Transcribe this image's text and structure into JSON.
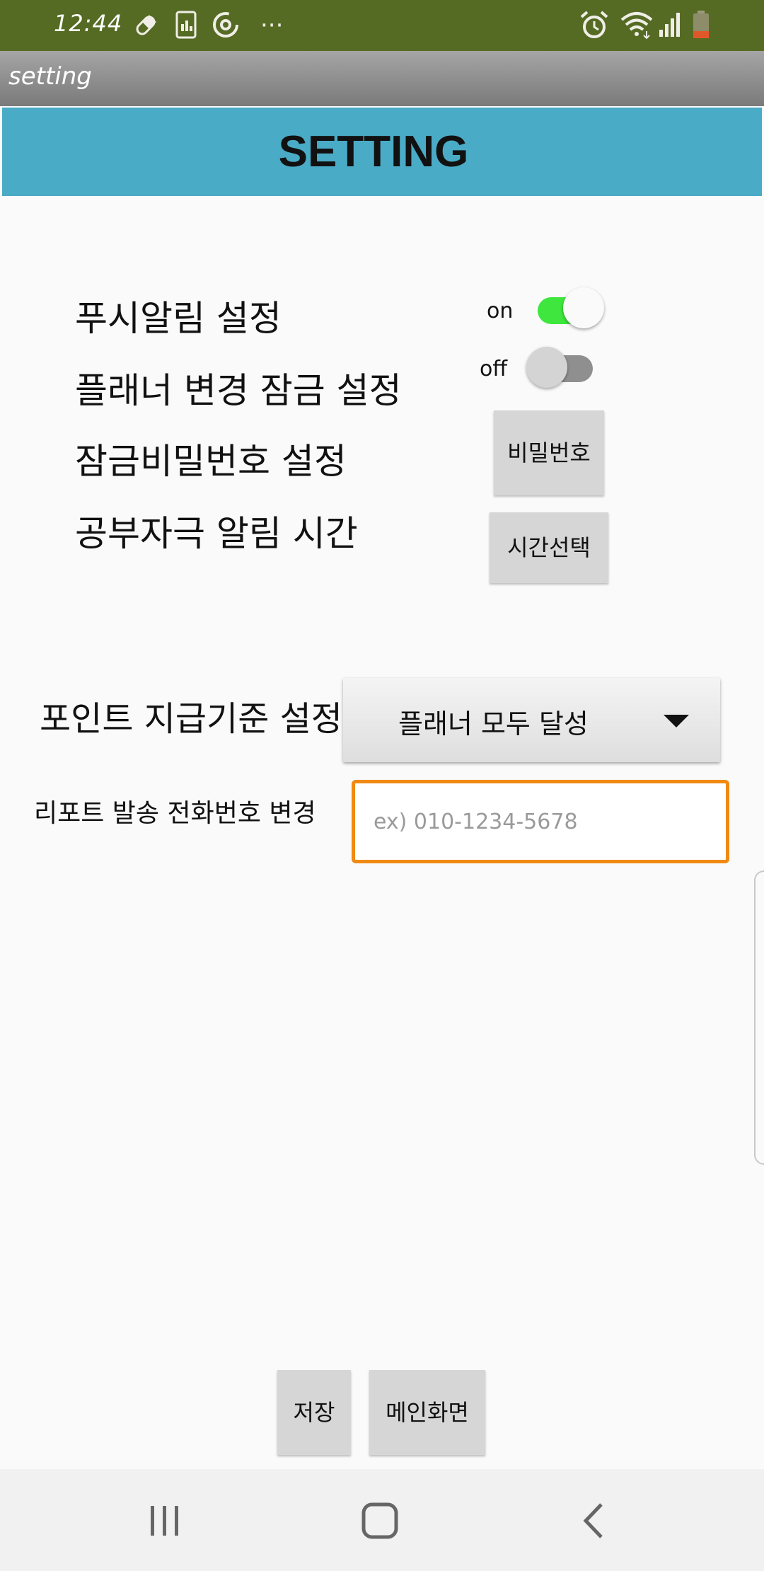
{
  "status_bar": {
    "time": "12:44",
    "left_icons": [
      "pill-icon",
      "tablet-chart-icon",
      "sync-icon",
      "more-dots-icon"
    ],
    "right_icons": [
      "alarm-icon",
      "wifi-icon",
      "signal-icon",
      "battery-icon"
    ],
    "more_glyph": "···"
  },
  "title_bar": {
    "title": "setting"
  },
  "header": {
    "title": "SETTING"
  },
  "settings": {
    "push_notification": {
      "label": "푸시알림 설정",
      "state_text": "on",
      "enabled": true
    },
    "planner_lock": {
      "label": "플래너 변경 잠금 설정",
      "state_text": "off",
      "enabled": false
    },
    "lock_password": {
      "label": "잠금비밀번호 설정",
      "button_label": "비밀번호"
    },
    "study_alarm_time": {
      "label": "공부자극 알림 시간",
      "button_label": "시간선택"
    },
    "point_criteria": {
      "label": "포인트 지급기준 설정",
      "selected": "플래너 모두 달성"
    },
    "report_phone": {
      "label": "리포트 발송 전화번호 변경",
      "placeholder": "ex) 010-1234-5678",
      "value": ""
    }
  },
  "actions": {
    "save_label": "저장",
    "main_screen_label": "메인화면"
  },
  "colors": {
    "status_bar": "#556b24",
    "header": "#4aabc7",
    "switch_on_track": "#3ee63e",
    "input_border": "#f08a12",
    "button_gray": "#d6d6d6"
  },
  "nav_bar": {
    "items": [
      "recent-apps-icon",
      "home-icon",
      "back-icon"
    ]
  }
}
